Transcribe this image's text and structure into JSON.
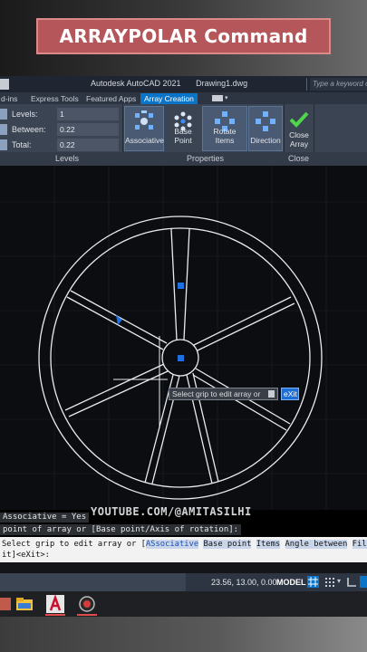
{
  "banner": {
    "title": "ARRAYPOLAR Command"
  },
  "titlebar": {
    "app": "Autodesk AutoCAD 2021",
    "file": "Drawing1.dwg",
    "search_placeholder": "Type a keyword or phrase"
  },
  "tabs": [
    {
      "label": "d-ins"
    },
    {
      "label": "Express Tools"
    },
    {
      "label": "Featured Apps"
    },
    {
      "label": "Array Creation"
    }
  ],
  "levels_panel": {
    "fields": [
      {
        "label": "Levels:",
        "value": "1"
      },
      {
        "label": "Between:",
        "value": "0.22"
      },
      {
        "label": "Total:",
        "value": "0.22"
      }
    ],
    "footer": "Levels"
  },
  "properties_panel": {
    "buttons": [
      {
        "label": "Associative"
      },
      {
        "label": "Base Point"
      },
      {
        "label": "Rotate Items"
      },
      {
        "label": "Direction"
      }
    ],
    "footer": "Properties"
  },
  "close_panel": {
    "label_line1": "Close",
    "label_line2": "Array",
    "footer": "Close"
  },
  "tooltip": {
    "text": "Select grip to edit array or",
    "option": "eXit"
  },
  "watermark": "YOUTUBE.COM/@AMITASILHI",
  "command_history": [
    "Associative = Yes",
    " point of array or [Base point/Axis of rotation]:"
  ],
  "command_line": {
    "part1": "Select grip to edit array or [",
    "opts": [
      "ASsociative",
      "Base point",
      "Items",
      "Angle between",
      "Fill angle"
    ],
    "line2": "it]<eXit>:"
  },
  "statusbar": {
    "coords": "23.56, 13.00, 0.00",
    "model": "MODEL"
  },
  "colors": {
    "accent": "#0a74c8",
    "grip": "#1e6fe0",
    "banner": "#b5575a"
  }
}
